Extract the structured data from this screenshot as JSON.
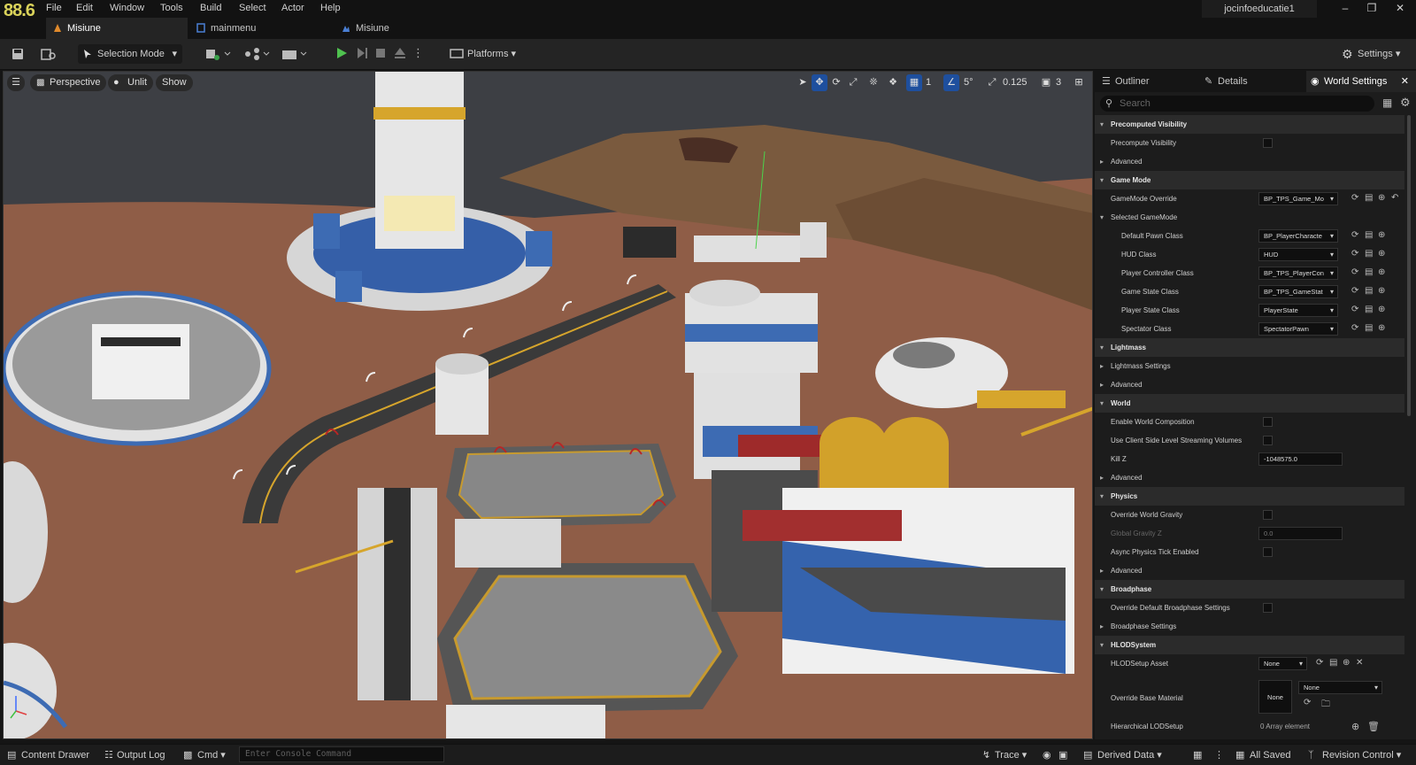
{
  "fps": "88.6",
  "menu": [
    "File",
    "Edit",
    "Window",
    "Tools",
    "Build",
    "Select",
    "Actor",
    "Help"
  ],
  "user": "jocinfoeducatie1",
  "tabs": [
    {
      "label": "Misiune",
      "active": true,
      "icon": "level-icon"
    },
    {
      "label": "mainmenu",
      "active": false,
      "icon": "widget-icon"
    },
    {
      "label": "Misiune",
      "active": false,
      "icon": "map-icon"
    }
  ],
  "toolbar": {
    "selection_mode": "Selection Mode",
    "platforms": "Platforms",
    "settings": "Settings"
  },
  "viewport": {
    "perspective": "Perspective",
    "lighting": "Unlit",
    "show": "Show",
    "grid_value": "1",
    "angle_value": "5°",
    "scale_value": "0.125",
    "camera_speed": "3"
  },
  "panel": {
    "tabs": [
      {
        "label": "Outliner",
        "active": false
      },
      {
        "label": "Details",
        "active": false
      },
      {
        "label": "World Settings",
        "active": true
      }
    ],
    "search_placeholder": "Search",
    "rows": [
      {
        "type": "cat",
        "label": "Precomputed Visibility"
      },
      {
        "type": "check",
        "label": "Precompute Visibility",
        "indent": 1
      },
      {
        "type": "sub",
        "label": "Advanced"
      },
      {
        "type": "cat",
        "label": "Game Mode"
      },
      {
        "type": "combo",
        "label": "GameMode Override",
        "value": "BP_TPS_Game_Mo",
        "actions": "reset",
        "indent": 1
      },
      {
        "type": "subcat",
        "label": "Selected GameMode"
      },
      {
        "type": "combo",
        "label": "Default Pawn Class",
        "value": "BP_PlayerCharacte",
        "indent": 2
      },
      {
        "type": "combo",
        "label": "HUD Class",
        "value": "HUD",
        "indent": 2
      },
      {
        "type": "combo",
        "label": "Player Controller Class",
        "value": "BP_TPS_PlayerCon",
        "indent": 2
      },
      {
        "type": "combo",
        "label": "Game State Class",
        "value": "BP_TPS_GameStat",
        "indent": 2
      },
      {
        "type": "combo",
        "label": "Player State Class",
        "value": "PlayerState",
        "indent": 2
      },
      {
        "type": "combo",
        "label": "Spectator Class",
        "value": "SpectatorPawn",
        "indent": 2
      },
      {
        "type": "cat",
        "label": "Lightmass"
      },
      {
        "type": "sub",
        "label": "Lightmass Settings"
      },
      {
        "type": "sub",
        "label": "Advanced"
      },
      {
        "type": "cat",
        "label": "World"
      },
      {
        "type": "check",
        "label": "Enable World Composition",
        "indent": 1
      },
      {
        "type": "check",
        "label": "Use Client Side Level Streaming Volumes",
        "indent": 1
      },
      {
        "type": "field",
        "label": "Kill Z",
        "value": "-1048575.0",
        "indent": 1
      },
      {
        "type": "sub",
        "label": "Advanced"
      },
      {
        "type": "cat",
        "label": "Physics"
      },
      {
        "type": "check",
        "label": "Override World Gravity",
        "indent": 1
      },
      {
        "type": "fielddim",
        "label": "Global Gravity Z",
        "value": "0.0",
        "indent": 1
      },
      {
        "type": "check",
        "label": "Async Physics Tick Enabled",
        "indent": 1
      },
      {
        "type": "sub",
        "label": "Advanced"
      },
      {
        "type": "cat",
        "label": "Broadphase"
      },
      {
        "type": "check",
        "label": "Override Default Broadphase Settings",
        "indent": 1
      },
      {
        "type": "sub",
        "label": "Broadphase Settings"
      },
      {
        "type": "cat",
        "label": "HLODSystem"
      },
      {
        "type": "combo",
        "label": "HLODSetup Asset",
        "value": "None",
        "indent": 1
      }
    ],
    "override_base_material": {
      "label": "Override Base Material",
      "thumb": "None",
      "value": "None"
    },
    "hierarchical_lod": {
      "label": "Hierarchical LODSetup",
      "value": "0 Array element"
    }
  },
  "statusbar": {
    "content_drawer": "Content Drawer",
    "output_log": "Output Log",
    "cmd": "Cmd",
    "console_placeholder": "Enter Console Command",
    "trace": "Trace",
    "derived_data": "Derived Data",
    "all_saved": "All Saved",
    "revision_control": "Revision Control"
  }
}
